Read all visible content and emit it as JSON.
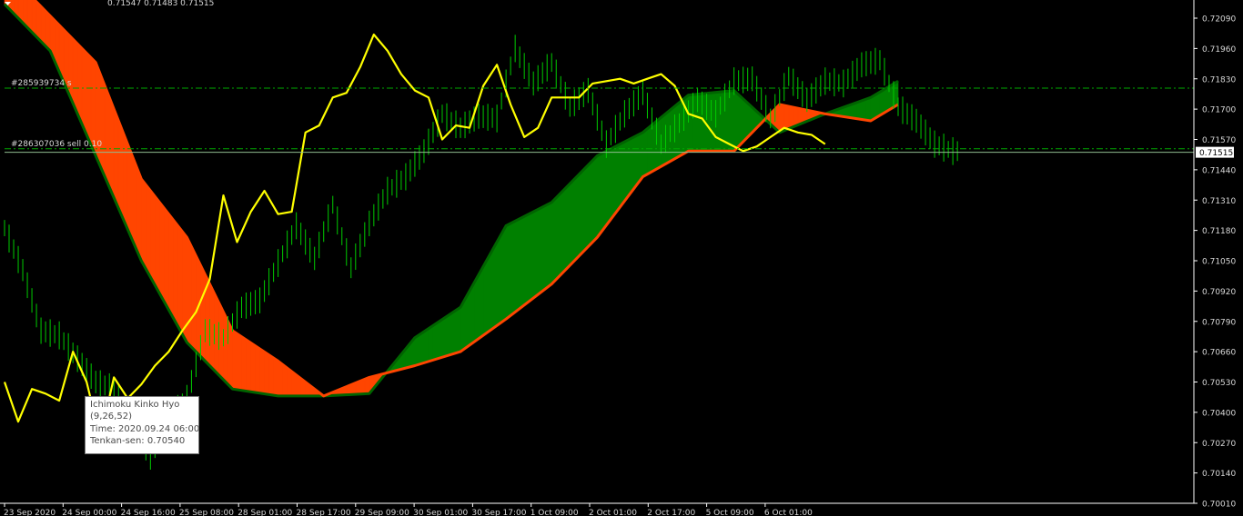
{
  "header": {
    "ohlc_text": "0.71547 0.71483 0.71515"
  },
  "colors": {
    "background": "#000000",
    "price": "#00cc00",
    "tenkan": "#ffff00",
    "kumo_bear": "#ff4500",
    "kumo_bull": "#008000",
    "order_line": "#00a800",
    "bid_line": "#8fbc8f",
    "axis": "#ffffff"
  },
  "orders": [
    {
      "label": "#285939734 s",
      "price": 0.7179
    },
    {
      "label": "#286307036 sell 0.10",
      "price": 0.7153
    }
  ],
  "bid": {
    "price": 0.71515,
    "label": "0.71515"
  },
  "tooltip": {
    "title": "Ichimoku Kinko Hyo",
    "params": "(9,26,52)",
    "time": "Time: 2020.09.24 06:00",
    "value": "Tenkan-sen: 0.70540"
  },
  "chart_data": {
    "type": "line",
    "title": "",
    "ylim": [
      0.7001,
      0.7215
    ],
    "y_ticks": [
      "0.72090",
      "0.71960",
      "0.71830",
      "0.71700",
      "0.71570",
      "0.71440",
      "0.71310",
      "0.71180",
      "0.71050",
      "0.70920",
      "0.70790",
      "0.70660",
      "0.70530",
      "0.70400",
      "0.70270",
      "0.70140",
      "0.70010"
    ],
    "x_ticks": [
      "23 Sep 2020",
      "24 Sep 00:00",
      "24 Sep 16:00",
      "25 Sep 08:00",
      "28 Sep 01:00",
      "28 Sep 17:00",
      "29 Sep 09:00",
      "30 Sep 01:00",
      "30 Sep 17:00",
      "1 Oct 09:00",
      "2 Oct 01:00",
      "2 Oct 17:00",
      "5 Oct 09:00",
      "6 Oct 01:00"
    ],
    "x_index": [
      0,
      1,
      2,
      3,
      4,
      5,
      6,
      7,
      8,
      9,
      10,
      11,
      12,
      13,
      14,
      15,
      16,
      17,
      18,
      19,
      20,
      21,
      22,
      23,
      24,
      25,
      26,
      27,
      28,
      29,
      30,
      31,
      32,
      33,
      34,
      35,
      36,
      37,
      38,
      39,
      40,
      41,
      42,
      43,
      44,
      45,
      46,
      47,
      48,
      49,
      50,
      51,
      52,
      53,
      54,
      55,
      56,
      57,
      58,
      59,
      60,
      61,
      62,
      63,
      64,
      65,
      66,
      67,
      68,
      69,
      70,
      71,
      72,
      73,
      74,
      75,
      76,
      77,
      78,
      79,
      80,
      81,
      82,
      83,
      84,
      85,
      86,
      87,
      88,
      89,
      90,
      91,
      92,
      93,
      94,
      95,
      96,
      97,
      98,
      99,
      100,
      101,
      102,
      103,
      104,
      105,
      106,
      107,
      108,
      109,
      110,
      111,
      112,
      113,
      114,
      115,
      116,
      117,
      118,
      119,
      120,
      121,
      122,
      123,
      124,
      125,
      126,
      127,
      128,
      129,
      130,
      131,
      132,
      133,
      134,
      135,
      136,
      137,
      138,
      139,
      140,
      141,
      142,
      143,
      144,
      145,
      146,
      147,
      148,
      149,
      150,
      151,
      152,
      153,
      154,
      155,
      156,
      157,
      158,
      159,
      160,
      161,
      162,
      163,
      164,
      165,
      166,
      167,
      168,
      169,
      170,
      171,
      172,
      173,
      174,
      175,
      176,
      177,
      178,
      179,
      180,
      181,
      182,
      183,
      184,
      185,
      186,
      187,
      188,
      189,
      190,
      191,
      192,
      193,
      194,
      195
    ],
    "series": [
      {
        "name": "",
        "role": "price",
        "x": [
          0,
          4,
          8,
          12,
          16,
          20,
          24,
          28,
          32,
          36,
          40,
          44,
          48,
          52,
          56,
          60,
          64,
          68,
          72,
          76,
          80,
          84,
          88,
          92,
          96,
          100,
          104,
          108,
          112,
          116,
          120,
          124,
          128,
          132,
          136,
          140,
          144,
          148,
          152,
          156,
          160,
          164,
          168,
          172,
          176,
          180,
          184,
          188,
          192,
          196,
          200,
          204,
          208
        ],
        "y": [
          0.7119,
          0.7101,
          0.7075,
          0.7073,
          0.7063,
          0.7053,
          0.705,
          0.7035,
          0.7021,
          0.7037,
          0.7046,
          0.7075,
          0.7072,
          0.7085,
          0.7088,
          0.7104,
          0.712,
          0.7106,
          0.7129,
          0.7102,
          0.7121,
          0.7135,
          0.7141,
          0.7152,
          0.7168,
          0.7162,
          0.7167,
          0.7166,
          0.7196,
          0.7181,
          0.719,
          0.7171,
          0.7178,
          0.7155,
          0.7168,
          0.7177,
          0.7155,
          0.7164,
          0.7174,
          0.7168,
          0.7182,
          0.7183,
          0.7166,
          0.7184,
          0.7174,
          0.7182,
          0.7181,
          0.7189,
          0.7191,
          0.7171,
          0.7165,
          0.7155,
          0.7152
        ]
      },
      {
        "name": "",
        "role": "tenkan",
        "x": [
          0,
          3,
          6,
          9,
          12,
          15,
          18,
          21,
          24,
          27,
          30,
          33,
          36,
          39,
          42,
          45,
          48,
          51,
          54,
          57,
          60,
          63,
          66,
          69,
          72,
          75,
          78,
          81,
          84,
          87,
          90,
          93,
          96,
          99,
          102,
          105,
          108,
          111,
          114,
          117,
          120,
          123,
          126,
          129,
          132,
          135,
          138,
          141,
          144,
          147,
          150,
          153,
          156,
          159,
          162,
          165,
          168,
          171,
          174,
          177,
          180
        ],
        "y": [
          0.7053,
          0.7036,
          0.705,
          0.7048,
          0.7045,
          0.7066,
          0.7053,
          0.7029,
          0.7055,
          0.7046,
          0.7052,
          0.706,
          0.7066,
          0.7075,
          0.7083,
          0.7097,
          0.7133,
          0.7113,
          0.7126,
          0.7135,
          0.7125,
          0.7126,
          0.716,
          0.7163,
          0.7175,
          0.7177,
          0.7188,
          0.7202,
          0.7195,
          0.7185,
          0.7178,
          0.7175,
          0.7157,
          0.7163,
          0.7162,
          0.718,
          0.7189,
          0.7172,
          0.7158,
          0.7162,
          0.7175,
          0.7175,
          0.7175,
          0.7181,
          0.7182,
          0.7183,
          0.7181,
          0.7183,
          0.7185,
          0.718,
          0.7168,
          0.7166,
          0.7158,
          0.7155,
          0.7152,
          0.7154,
          0.7158,
          0.7162,
          0.716,
          0.7159,
          0.7155
        ]
      },
      {
        "name": "",
        "role": "senkou_a",
        "x": [
          0,
          10,
          20,
          30,
          40,
          50,
          60,
          70,
          80,
          90,
          100,
          110,
          120,
          130,
          140,
          150,
          160,
          170,
          180,
          190,
          196
        ],
        "y": [
          0.7215,
          0.7195,
          0.715,
          0.7105,
          0.707,
          0.705,
          0.7047,
          0.7047,
          0.7048,
          0.7072,
          0.7085,
          0.712,
          0.713,
          0.715,
          0.716,
          0.7176,
          0.7178,
          0.716,
          0.7168,
          0.7175,
          0.7182
        ]
      },
      {
        "name": "",
        "role": "senkou_b",
        "x": [
          0,
          10,
          20,
          30,
          40,
          50,
          60,
          70,
          80,
          90,
          100,
          110,
          120,
          130,
          140,
          150,
          160,
          170,
          180,
          190,
          196
        ],
        "y": [
          0.723,
          0.721,
          0.719,
          0.714,
          0.7115,
          0.7075,
          0.7062,
          0.7047,
          0.7055,
          0.706,
          0.7066,
          0.708,
          0.7095,
          0.7115,
          0.7141,
          0.7152,
          0.7152,
          0.7172,
          0.7168,
          0.7165,
          0.7172
        ]
      }
    ]
  }
}
